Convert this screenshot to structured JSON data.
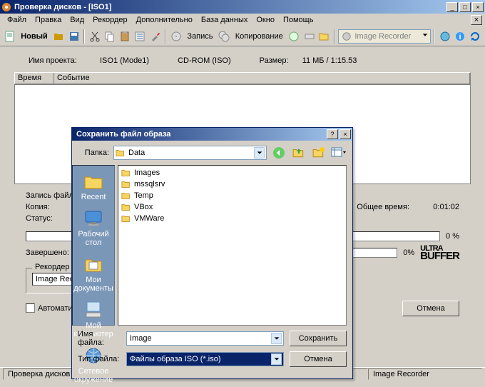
{
  "window": {
    "title": "Проверка дисков - [ISO1]"
  },
  "menu": {
    "file": "Файл",
    "edit": "Правка",
    "view": "Вид",
    "recorder": "Рекордер",
    "extra": "Дополнительно",
    "database": "База данных",
    "window": "Окно",
    "help": "Помощь"
  },
  "toolbar": {
    "new": "Новый",
    "burn": "Запись",
    "copy": "Копирование",
    "device_combo": "Image Recorder"
  },
  "project": {
    "name_label": "Имя проекта:",
    "name_value": "ISO1 (Mode1)",
    "type_value": "CD-ROM (ISO)",
    "size_label": "Размер:",
    "size_value": "11 МБ  /  1:15.53"
  },
  "columns": {
    "time": "Время",
    "event": "Событие"
  },
  "status": {
    "write_file": "Запись файла:",
    "copy": "Копия:",
    "status": "Статус:",
    "total_time_label": "Общее время:",
    "total_time_value": "0:01:02",
    "remaining_pct": "0 %",
    "done_label": "Завершено:",
    "done_val": "0%",
    "ultra1": "ULTRA",
    "ultra2": "BUFFER"
  },
  "recorder_box": {
    "legend": "Рекордер",
    "value": "Image Recorder"
  },
  "auto_checkbox": "Автоматически",
  "cancel_button": "Отмена",
  "statusbar": {
    "left": "Проверка дисков",
    "right": "Image Recorder"
  },
  "dialog": {
    "title": "Сохранить файл образа",
    "folder_label": "Папка:",
    "folder_value": "Data",
    "places": {
      "recent": "Recent",
      "desktop": "Рабочий стол",
      "mydocs": "Мои документы",
      "mycomp": "Мой компьютер",
      "network": "Сетевое окружение"
    },
    "folders": [
      "Images",
      "mssqlsrv",
      "Temp",
      "VBox",
      "VMWare"
    ],
    "filename_label": "Имя файла:",
    "filename_value": "Image",
    "filetype_label": "Тип файла:",
    "filetype_value": "Файлы образа ISO (*.iso)",
    "save": "Сохранить",
    "cancel": "Отмена"
  }
}
